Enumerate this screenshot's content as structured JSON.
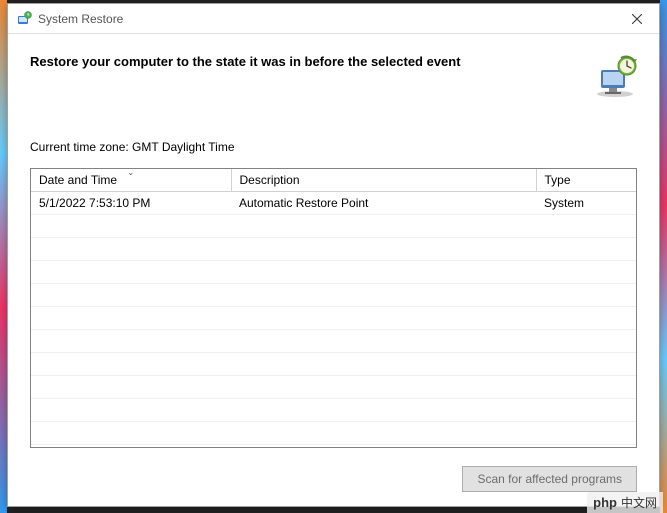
{
  "window": {
    "title": "System Restore"
  },
  "header": {
    "title": "Restore your computer to the state it was in before the selected event"
  },
  "content": {
    "timezone_label": "Current time zone: GMT Daylight Time"
  },
  "table": {
    "columns": {
      "date": "Date and Time",
      "description": "Description",
      "type": "Type"
    },
    "rows": [
      {
        "date": "5/1/2022 7:53:10 PM",
        "description": "Automatic Restore Point",
        "type": "System"
      }
    ]
  },
  "footer": {
    "scan_button": "Scan for affected programs"
  },
  "watermark": {
    "brand": "php",
    "text": "中文网"
  }
}
